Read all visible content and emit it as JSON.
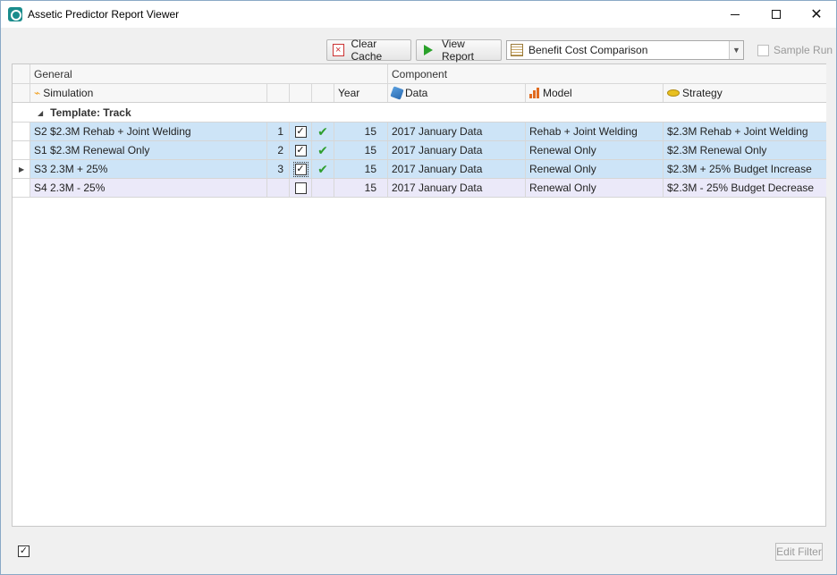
{
  "window": {
    "title": "Assetic Predictor Report Viewer",
    "minimize_glyph": "—",
    "close_glyph": "✕"
  },
  "toolbar": {
    "clear_cache_label": "Clear Cache",
    "view_report_label": "View Report",
    "report_selected": "Benefit Cost Comparison",
    "sample_run_label": "Sample Run",
    "sample_run_checked": false
  },
  "grid": {
    "bands": {
      "general": "General",
      "component": "Component"
    },
    "columns": {
      "simulation": "Simulation",
      "year": "Year",
      "data": "Data",
      "model": "Model",
      "strategy": "Strategy"
    },
    "group_label": "Template: Track",
    "rows": [
      {
        "simulation": "S2 $2.3M Rehab + Joint Welding",
        "num": "1",
        "checked": true,
        "ok": true,
        "year": "15",
        "data": "2017 January Data",
        "model": "Rehab + Joint Welding",
        "strategy": "$2.3M Rehab + Joint Welding"
      },
      {
        "simulation": "S1 $2.3M Renewal Only",
        "num": "2",
        "checked": true,
        "ok": true,
        "year": "15",
        "data": "2017 January Data",
        "model": "Renewal Only",
        "strategy": "$2.3M Renewal Only"
      },
      {
        "simulation": "S3 2.3M + 25%",
        "num": "3",
        "checked": true,
        "ok": true,
        "year": "15",
        "data": "2017 January Data",
        "model": "Renewal Only",
        "strategy": "$2.3M + 25% Budget Increase"
      },
      {
        "simulation": "S4 2.3M - 25%",
        "num": "",
        "checked": false,
        "ok": false,
        "year": "15",
        "data": "2017 January Data",
        "model": "Renewal Only",
        "strategy": "$2.3M - 25% Budget Decrease"
      }
    ]
  },
  "footer": {
    "select_all_checked": true,
    "edit_filter_label": "Edit Filter"
  },
  "icons": {
    "check_glyph": "✓",
    "ok_glyph": "✔",
    "current_row_glyph": "▶",
    "expanded_glyph": "◢",
    "dropdown_glyph": "▼",
    "sim_glyph": "⌁"
  }
}
